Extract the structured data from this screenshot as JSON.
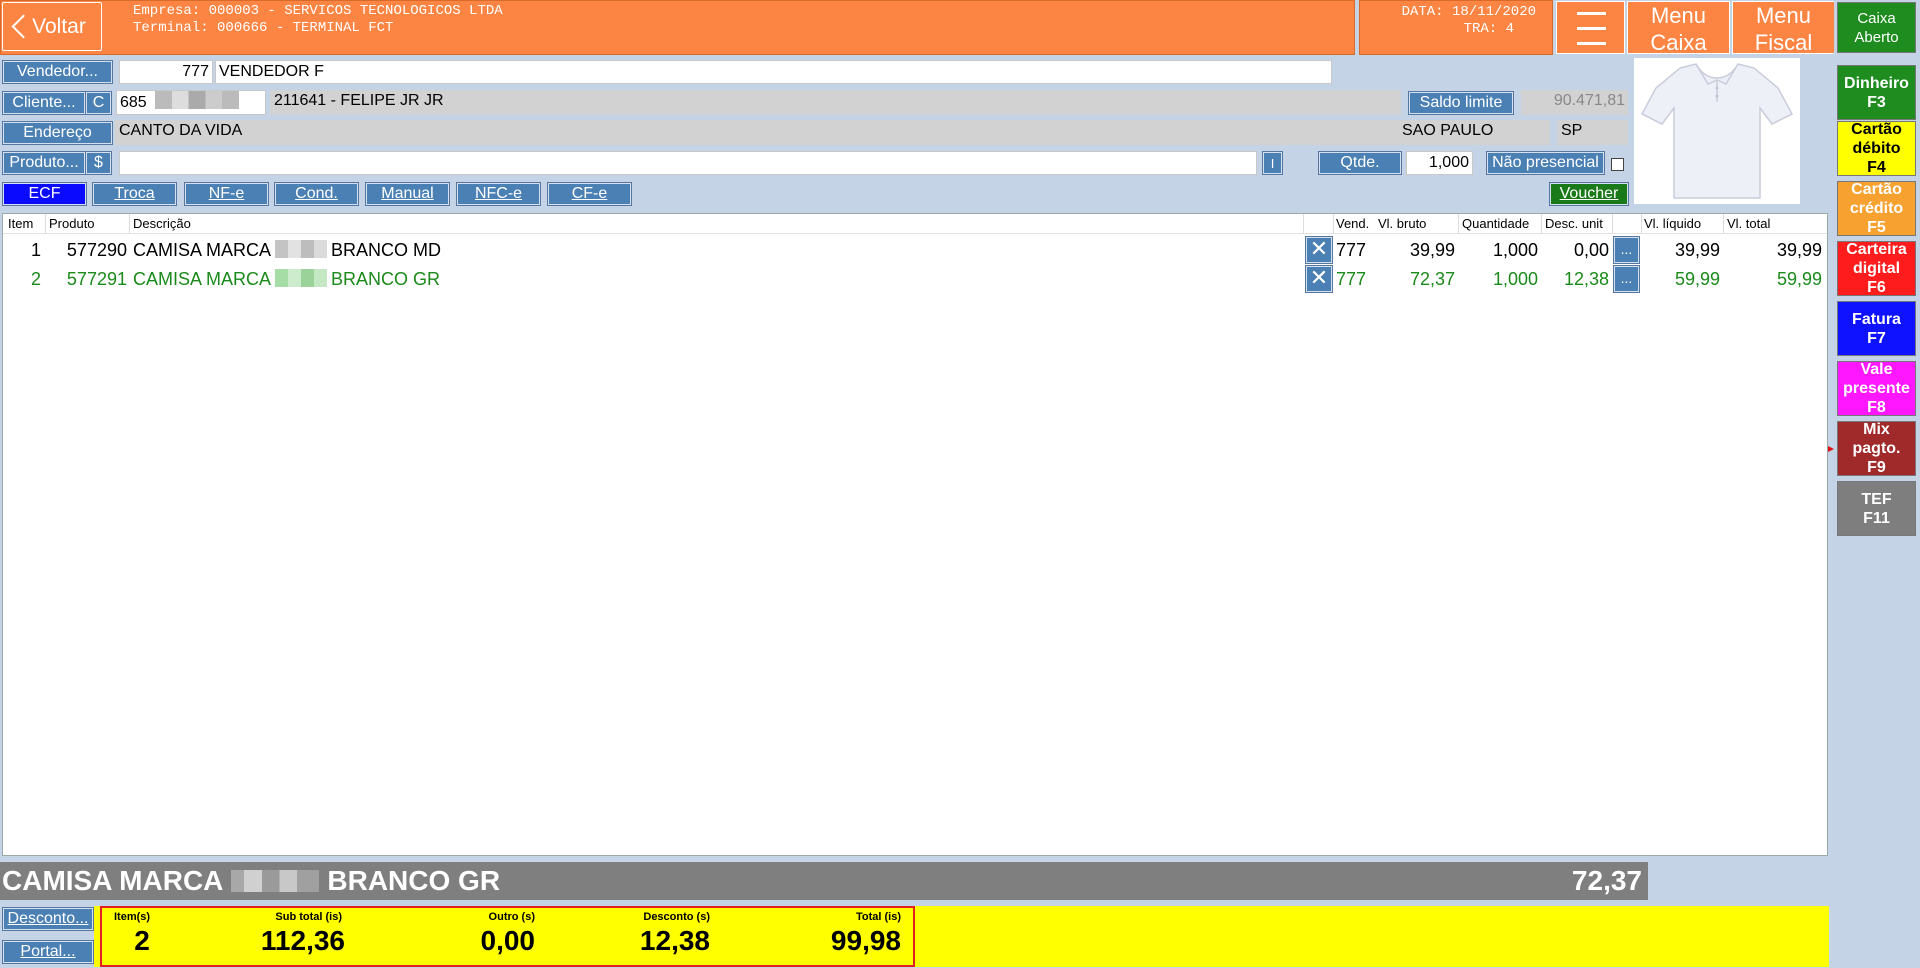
{
  "header": {
    "back_label": "Voltar",
    "empresa": "Empresa: 000003 - SERVICOS TECNOLOGICOS LTDA",
    "terminal": "Terminal: 000666 - TERMINAL FCT",
    "data": "DATA: 18/11/2020",
    "tra": "TRA: 4",
    "menu_caixa_line1": "Menu",
    "menu_caixa_line2": "Caixa",
    "menu_fiscal_line1": "Menu",
    "menu_fiscal_line2": "Fiscal"
  },
  "status": {
    "caixa_line1": "Caixa",
    "caixa_line2": "Aberto"
  },
  "payments": [
    {
      "line1": "Dinheiro",
      "line2": "F3",
      "line3": "",
      "bg": "#1e8c1e",
      "fg": "#ffffff"
    },
    {
      "line1": "Cartão",
      "line2": "débito",
      "line3": "F4",
      "bg": "#ffff00",
      "fg": "#000000"
    },
    {
      "line1": "Cartão",
      "line2": "crédito",
      "line3": "F5",
      "bg": "#f7a130",
      "fg": "#ffffff"
    },
    {
      "line1": "Carteira",
      "line2": "digital",
      "line3": "F6",
      "bg": "#ff1c1c",
      "fg": "#ffffff"
    },
    {
      "line1": "Fatura",
      "line2": "F7",
      "line3": "",
      "bg": "#0f12ff",
      "fg": "#ffffff"
    },
    {
      "line1": "Vale",
      "line2": "presente",
      "line3": "F8",
      "bg": "#ff18ff",
      "fg": "#ffffff"
    },
    {
      "line1": "Mix",
      "line2": "pagto.",
      "line3": "F9",
      "bg": "#a02a2a",
      "fg": "#ffffff"
    },
    {
      "line1": "TEF",
      "line2": "F11",
      "line3": "",
      "bg": "#7e7e7e",
      "fg": "#ffffff"
    }
  ],
  "form": {
    "vendedor_btn": "Vendedor...",
    "vendedor_code": "777",
    "vendedor_name": "VENDEDOR F",
    "cliente_btn": "Cliente...",
    "cliente_c_btn": "C",
    "cliente_code": "685",
    "cliente_name": "211641 - FELIPE JR JR",
    "saldo_btn": "Saldo limite",
    "saldo_value": "90.471,81",
    "endereco_btn": "Endereço",
    "endereco": "CANTO DA VIDA",
    "cidade": "SAO PAULO",
    "uf": "SP",
    "produto_btn": "Produto...",
    "dollar_btn": "$",
    "produto_value": "",
    "i_btn": "I",
    "qtde_btn": "Qtde.",
    "qtde_value": "1,000",
    "nao_presencial_btn": "Não presencial",
    "voucher_btn": "Voucher"
  },
  "tabs": [
    "ECF",
    "Troca",
    "NF-e",
    "Cond.",
    "Manual",
    "NFC-e",
    "CF-e"
  ],
  "table": {
    "headers": {
      "item": "Item",
      "produto": "Produto",
      "descricao": "Descrição",
      "vend": "Vend.",
      "vl_bruto": "Vl. bruto",
      "quantidade": "Quantidade",
      "desc_unit": "Desc. unit",
      "vl_liquido": "Vl. líquido",
      "vl_total": "Vl. total"
    },
    "rows": [
      {
        "item": "1",
        "produto": "577290",
        "desc_a": "CAMISA MARCA",
        "desc_b": "BRANCO MD",
        "vend": "777",
        "vl_bruto": "39,99",
        "quantidade": "1,000",
        "desc_unit": "0,00",
        "dots": "...",
        "vl_liquido": "39,99",
        "vl_total": "39,99",
        "color": "#000000"
      },
      {
        "item": "2",
        "produto": "577291",
        "desc_a": "CAMISA MARCA",
        "desc_b": "BRANCO GR",
        "vend": "777",
        "vl_bruto": "72,37",
        "quantidade": "1,000",
        "desc_unit": "12,38",
        "dots": "...",
        "vl_liquido": "59,99",
        "vl_total": "59,99",
        "color": "#1a8a1a"
      }
    ]
  },
  "selected": {
    "desc_a": "CAMISA MARCA",
    "desc_b": "BRANCO GR",
    "price": "72,37"
  },
  "bottom": {
    "desconto_btn": "Desconto...",
    "portal_btn": "Portal..."
  },
  "totals": {
    "itens_label": "Item(s)",
    "itens": "2",
    "subtotal_label": "Sub total (is)",
    "subtotal": "112,36",
    "outro_label": "Outro (s)",
    "outro": "0,00",
    "desconto_label": "Desconto (s)",
    "desconto": "12,38",
    "total_label": "Total (is)",
    "total": "99,98"
  },
  "colors": {
    "header_orange": "#fd8544",
    "button_blue": "#4b80b4",
    "ecf_tab": "#0a0aff",
    "totals_yellow": "#ffff00"
  }
}
